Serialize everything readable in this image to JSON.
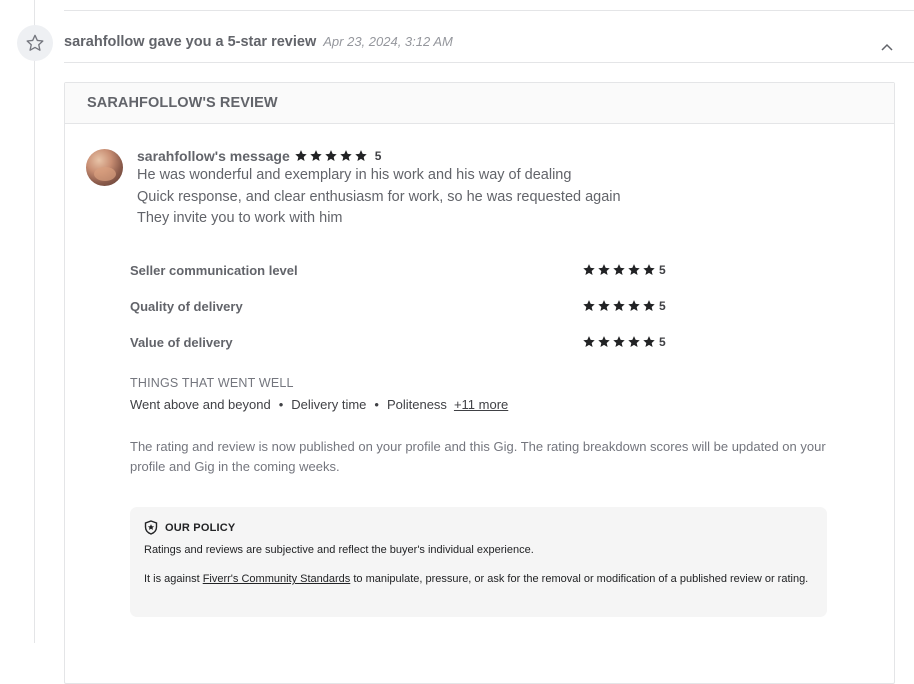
{
  "event": {
    "icon": "star-outline-icon",
    "title": "sarahfollow gave you a 5-star review",
    "time": "Apr 23, 2024, 3:12 AM",
    "collapse_icon": "chevron-up-icon"
  },
  "review": {
    "header": "SARAHFOLLOW'S REVIEW",
    "message_title": "sarahfollow's message",
    "overall_rating": "5",
    "rating_stars": 5,
    "lines": [
      "He was wonderful and exemplary in his work and his way of dealing",
      "Quick response, and clear enthusiasm for work, so he was requested again",
      "They invite you to work with him"
    ],
    "breakdown": [
      {
        "label": "Seller communication level",
        "rating": "5"
      },
      {
        "label": "Quality of delivery",
        "rating": "5"
      },
      {
        "label": "Value of delivery",
        "rating": "5"
      }
    ],
    "went_well": {
      "title": "THINGS THAT WENT WELL",
      "tags": [
        "Went above and beyond",
        "Delivery time",
        "Politeness"
      ],
      "more": "+11 more"
    },
    "published_note": "The rating and review is now published on your profile and this Gig. The rating breakdown scores will be updated on your profile and Gig in the coming weeks."
  },
  "policy": {
    "icon": "shield-star-icon",
    "title": "OUR POLICY",
    "line1": "Ratings and reviews are subjective and reflect the buyer's individual experience.",
    "line2_pre": "It is against ",
    "link": "Fiverr's Community Standards",
    "line2_post": " to manipulate, pressure, or ask for the removal or modification of a published review or rating."
  },
  "colors": {
    "star": "#222325",
    "muted": "#74767e",
    "title": "#62646a"
  }
}
